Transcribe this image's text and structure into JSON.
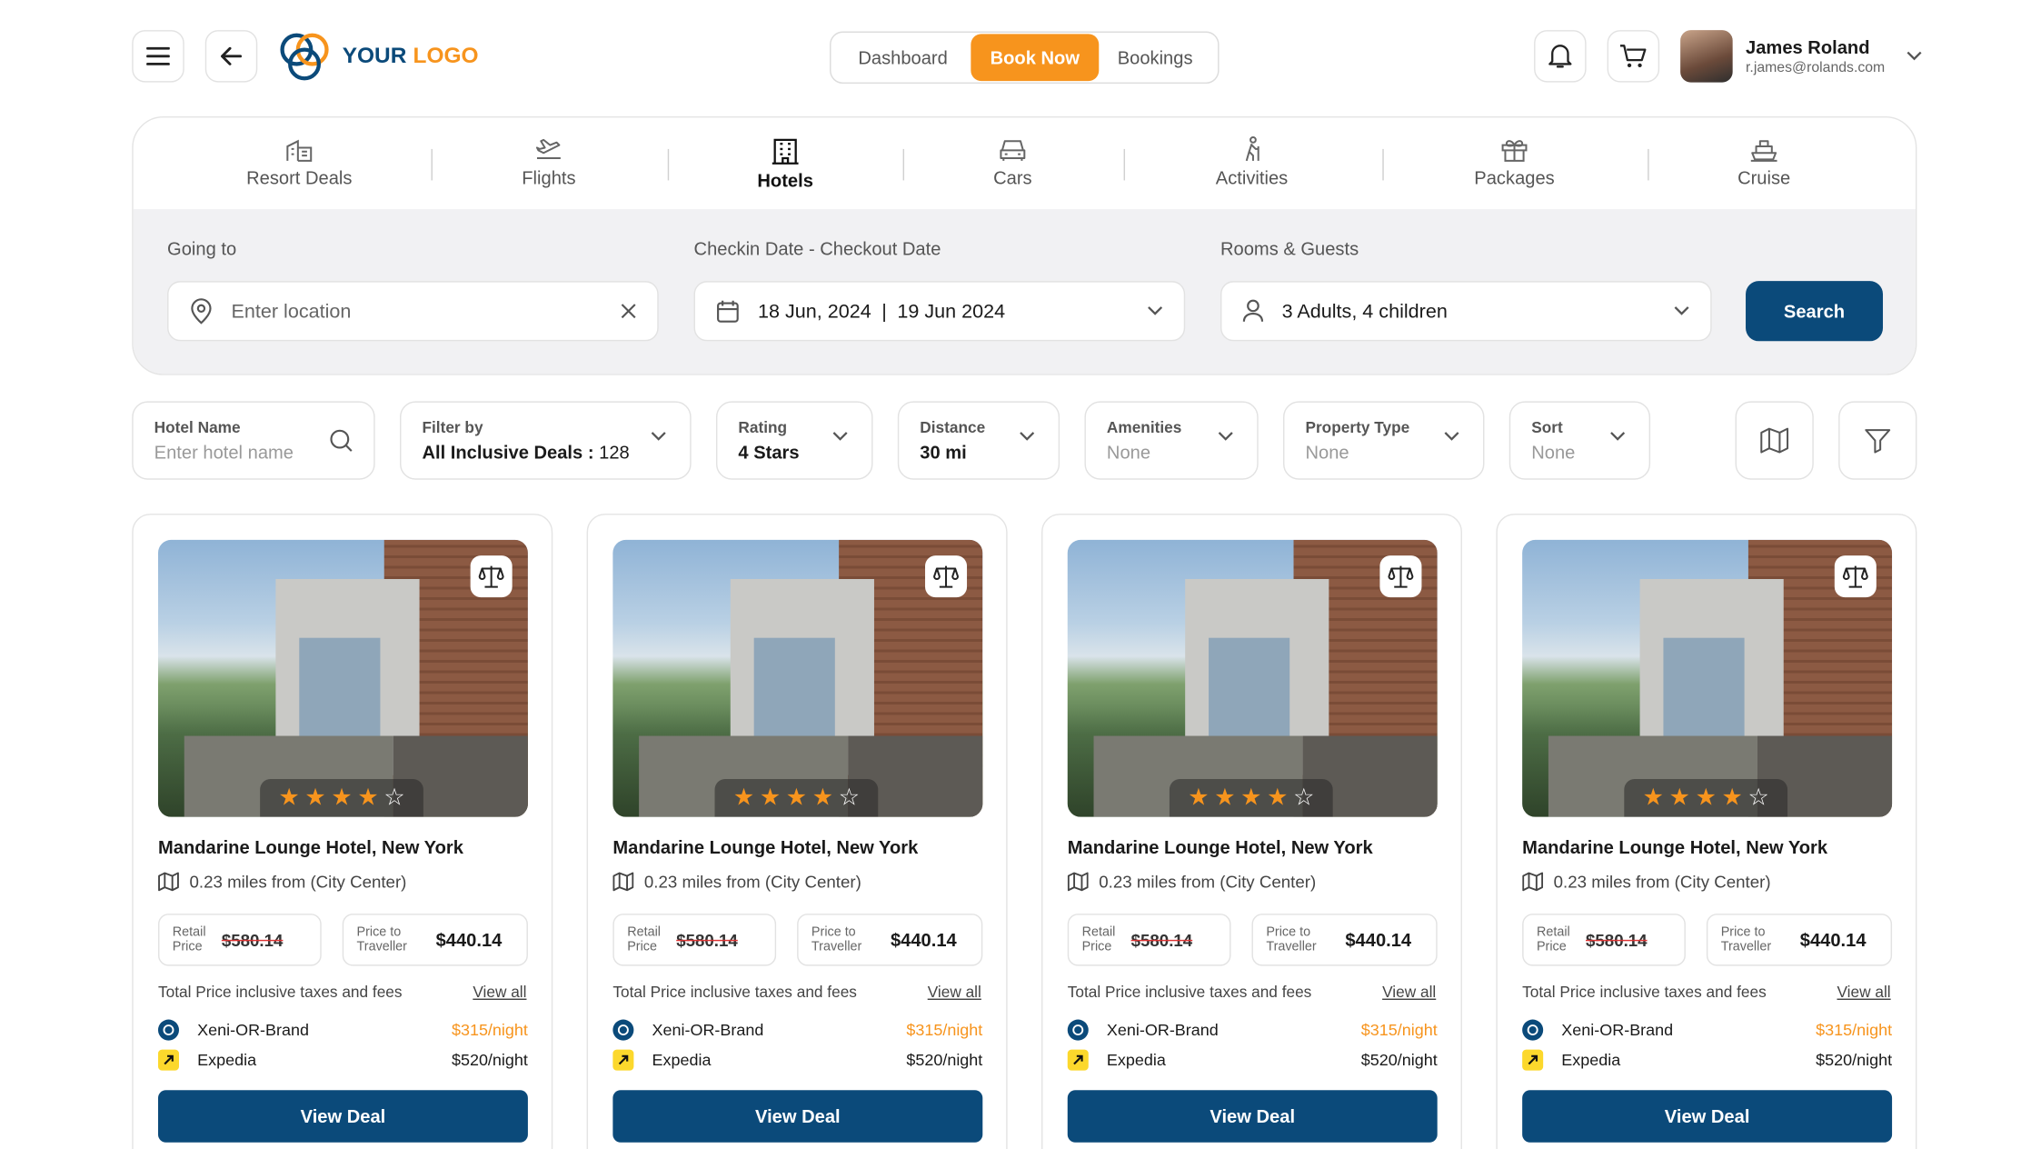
{
  "logo": {
    "word1": "YOUR",
    "word2": "LOGO"
  },
  "nav": {
    "items": [
      "Dashboard",
      "Book Now",
      "Bookings"
    ],
    "active": "Book Now"
  },
  "user": {
    "name": "James Roland",
    "email": "r.james@rolands.com"
  },
  "tabs": [
    "Resort Deals",
    "Flights",
    "Hotels",
    "Cars",
    "Activities",
    "Packages",
    "Cruise"
  ],
  "search": {
    "going_label": "Going to",
    "going_placeholder": "Enter location",
    "dates_label": "Checkin Date - Checkout Date",
    "checkin": "18 Jun, 2024",
    "divider": "|",
    "checkout": "19 Jun 2024",
    "guests_label": "Rooms & Guests",
    "guests_value": "3 Adults, 4 children",
    "button": "Search"
  },
  "filters": {
    "hotel_name": {
      "label": "Hotel Name",
      "placeholder": "Enter hotel name"
    },
    "filter_by": {
      "label": "Filter by",
      "value": "All Inclusive Deals : ",
      "count": "128"
    },
    "rating": {
      "label": "Rating",
      "value": "4 Stars"
    },
    "distance": {
      "label": "Distance",
      "value": "30 mi"
    },
    "amenities": {
      "label": "Amenities",
      "value": "None"
    },
    "property_type": {
      "label": "Property Type",
      "value": "None"
    },
    "sort": {
      "label": "Sort",
      "value": "None"
    }
  },
  "cards": [
    {
      "title": "Mandarine Lounge Hotel, New York",
      "distance": "0.23 miles from (City Center)",
      "retail_label_1": "Retail",
      "retail_label_2": "Price",
      "retail_price": "$580.14",
      "traveller_label_1": "Price to",
      "traveller_label_2": "Traveller",
      "traveller_price": "$440.14",
      "total_text": "Total Price inclusive taxes and fees",
      "view_all": "View all",
      "provider1": "Xeni-OR-Brand",
      "provider1_price": "$315/night",
      "provider2": "Expedia",
      "provider2_price": "$520/night",
      "button": "View Deal",
      "rating": 4
    },
    {
      "title": "Mandarine Lounge Hotel, New York",
      "distance": "0.23 miles from (City Center)",
      "retail_label_1": "Retail",
      "retail_label_2": "Price",
      "retail_price": "$580.14",
      "traveller_label_1": "Price to",
      "traveller_label_2": "Traveller",
      "traveller_price": "$440.14",
      "total_text": "Total Price inclusive taxes and fees",
      "view_all": "View all",
      "provider1": "Xeni-OR-Brand",
      "provider1_price": "$315/night",
      "provider2": "Expedia",
      "provider2_price": "$520/night",
      "button": "View Deal",
      "rating": 4
    },
    {
      "title": "Mandarine Lounge Hotel, New York",
      "distance": "0.23 miles from (City Center)",
      "retail_label_1": "Retail",
      "retail_label_2": "Price",
      "retail_price": "$580.14",
      "traveller_label_1": "Price to",
      "traveller_label_2": "Traveller",
      "traveller_price": "$440.14",
      "total_text": "Total Price inclusive taxes and fees",
      "view_all": "View all",
      "provider1": "Xeni-OR-Brand",
      "provider1_price": "$315/night",
      "provider2": "Expedia",
      "provider2_price": "$520/night",
      "button": "View Deal",
      "rating": 4
    },
    {
      "title": "Mandarine Lounge Hotel, New York",
      "distance": "0.23 miles from (City Center)",
      "retail_label_1": "Retail",
      "retail_label_2": "Price",
      "retail_price": "$580.14",
      "traveller_label_1": "Price to",
      "traveller_label_2": "Traveller",
      "traveller_price": "$440.14",
      "total_text": "Total Price inclusive taxes and fees",
      "view_all": "View all",
      "provider1": "Xeni-OR-Brand",
      "provider1_price": "$315/night",
      "provider2": "Expedia",
      "provider2_price": "$520/night",
      "button": "View Deal",
      "rating": 4
    }
  ],
  "colors": {
    "accent": "#f7941d",
    "primary": "#0b4a7a"
  }
}
